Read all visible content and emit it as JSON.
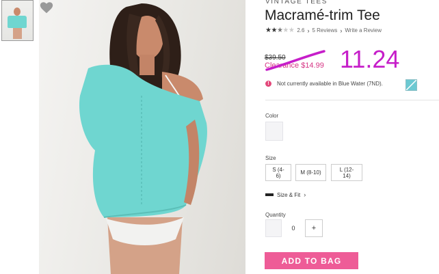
{
  "product": {
    "category": "VINTAGE TEES",
    "title": "Macramé-trim Tee",
    "rating_value": "2.6",
    "reviews_link": "5 Reviews",
    "write_review_link": "Write a Review"
  },
  "price": {
    "original": "$39.50",
    "clearance": "Clearance $14.99",
    "handwritten_annotation": "11.24"
  },
  "availability": {
    "alert_symbol": "!",
    "message": "Not currently available in Blue Water (7ND)."
  },
  "options": {
    "color_label": "Color",
    "size_label": "Size",
    "sizes": [
      "S (4-6)",
      "M (8-10)",
      "L (12-14)"
    ],
    "size_fit_link": "Size & Fit",
    "quantity_label": "Quantity",
    "quantity_value": "0",
    "quantity_plus": "+"
  },
  "actions": {
    "add_to_bag": "ADD TO BAG"
  },
  "icons": {
    "wishlist": "heart-icon",
    "alert": "alert-icon",
    "ruler": "ruler-icon",
    "chevron": "chevron-right-icon"
  },
  "colors": {
    "accent_pink": "#ee5c97",
    "clearance_pink": "#d63384",
    "annotation_magenta": "#c61ec9",
    "shirt_teal": "#6fd6d0"
  }
}
